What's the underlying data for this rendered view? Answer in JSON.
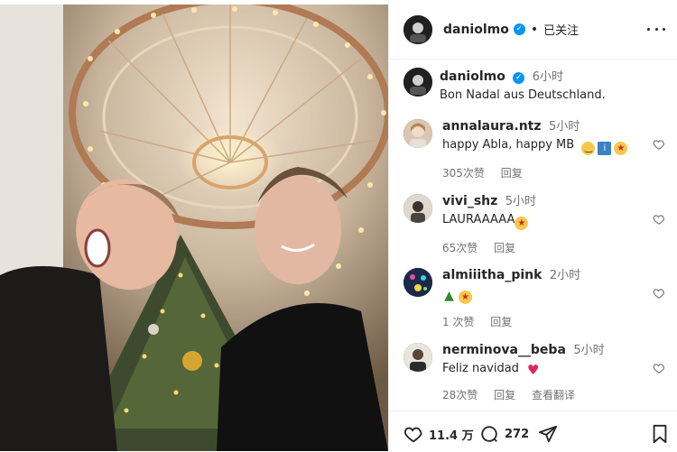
{
  "post": {
    "author": "daniolmo",
    "follow_status": "已关注",
    "separator": "•"
  },
  "caption": {
    "author": "daniolmo",
    "time": "6小时",
    "text": "Bon Nadal aus Deutschland."
  },
  "comments": [
    {
      "user": "annalaura.ntz",
      "time": "5小时",
      "text": "happy Abla, happy MB",
      "emojis": [
        "smiley-face-icon",
        "i-box-icon",
        "star-eyes-icon"
      ],
      "likes": "305次赞",
      "reply": "回复"
    },
    {
      "user": "vivi_shz",
      "time": "5小时",
      "text": "LAURAAAAA",
      "emojis": [
        "star-eyes-icon"
      ],
      "likes": "65次赞",
      "reply": "回复"
    },
    {
      "user": "almiiitha_pink",
      "time": "2小时",
      "text": "",
      "emojis": [
        "christmas-tree-icon",
        "star-eyes-icon"
      ],
      "likes": "1 次赞",
      "reply": "回复"
    },
    {
      "user": "nerminova__beba",
      "time": "5小时",
      "text": "Feliz navidad",
      "emojis": [
        "red-heart-icon"
      ],
      "likes": "28次赞",
      "reply": "回复",
      "translate": "查看翻译"
    }
  ],
  "actions": {
    "like_count": "11.4 万",
    "comment_count": "272"
  },
  "colors": {
    "verified": "#0095f6",
    "secondary_text": "#737373",
    "heart_red": "#e0245e",
    "divider": "#efefef"
  }
}
